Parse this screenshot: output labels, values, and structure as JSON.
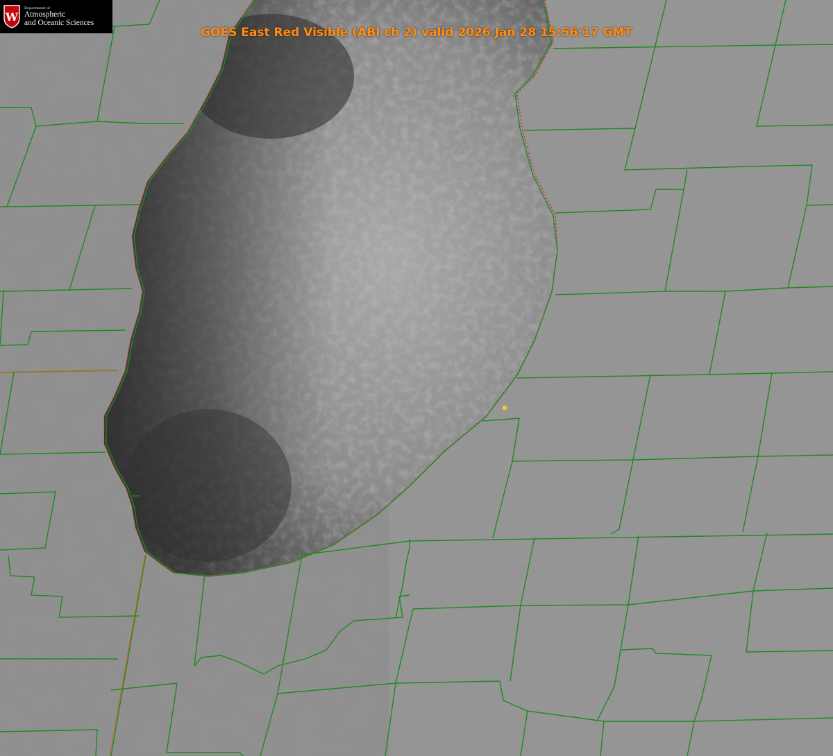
{
  "title": "GOES East Red Visible (ABI ch 2) valid 2026 Jan 28 15:56:17 GMT",
  "logo": {
    "dept_text": "Department of",
    "line1": "Atmospheric",
    "line2": "and Oceanic Sciences",
    "shield_letter": "W",
    "shield_color": "#c5050c"
  },
  "map": {
    "satellite": "GOES East",
    "channel": "Red Visible (ABI ch 2)",
    "valid_time": "2026 Jan 28 15:56:17 GMT",
    "features": [
      "county-boundaries",
      "state-boundary",
      "lake-shoreline",
      "observation-marker"
    ],
    "colors": {
      "county_lines": "#1f8a1f",
      "state_line": "#c76a1a",
      "shoreline_dotted": "#e02020",
      "marker": "#e0d020",
      "title_text": "#ff8c1a"
    }
  }
}
